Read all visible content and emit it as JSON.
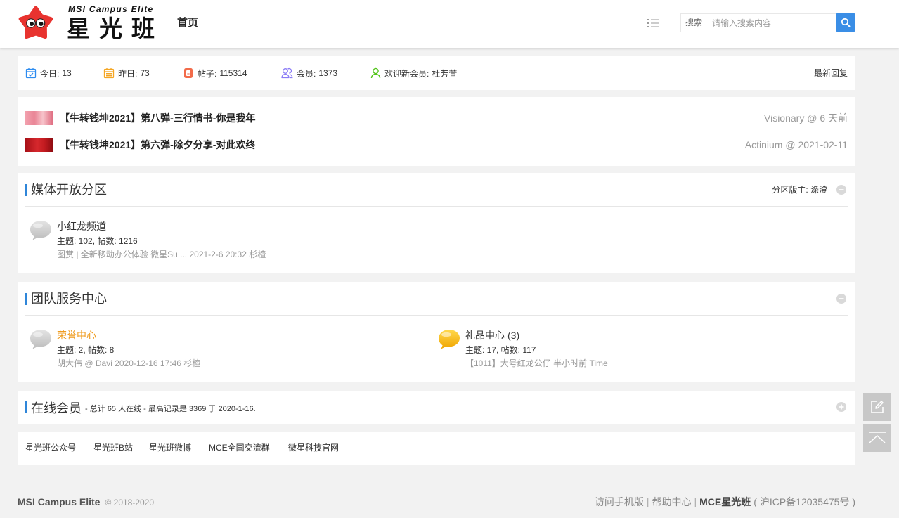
{
  "colors": {
    "accent": "#2f86d9",
    "search_button": "#3a8ee6",
    "highlight_forum": "#ef9b1d",
    "page_bg": "#f2f2f2",
    "logo_red": "#e8332f",
    "float_button": "#c8c8c8"
  },
  "header": {
    "logo_icon": "star-mascot-icon",
    "logo_small": "MSI Campus Elite",
    "logo_big": "星光班",
    "nav_home": "首页",
    "menu_icon": "list-icon",
    "search_label": "搜索",
    "search_placeholder": "请输入搜索内容",
    "search_value": "",
    "search_icon": "search-icon"
  },
  "stats": {
    "today": {
      "label": "今日:",
      "value": "13",
      "icon": "calendar-check-icon"
    },
    "yesterday": {
      "label": "昨日:",
      "value": "73",
      "icon": "calendar-icon"
    },
    "posts": {
      "label": "帖子:",
      "value": "115314",
      "icon": "document-icon"
    },
    "members": {
      "label": "会员:",
      "value": "1373",
      "icon": "users-icon"
    },
    "new_member": {
      "label": "欢迎新会员:",
      "value": "杜芳萱",
      "icon": "user-icon"
    },
    "latest_reply": "最新回复"
  },
  "featured": [
    {
      "title": "【牛转钱坤2021】第八弹-三行情书-你是我年",
      "meta": "Visionary @ 6 天前"
    },
    {
      "title": "【牛转钱坤2021】第六弹-除夕分享-对此欢终",
      "meta": "Actinium @ 2021-02-11"
    }
  ],
  "media_section": {
    "title": "媒体开放分区",
    "moderator": "分区版主: 涤澄",
    "toggle_icon": "collapse-icon",
    "forums": [
      {
        "name": "小红龙频道",
        "stats": "主题: 102, 帖数: 1216",
        "last_post": "图赏 | 全新移动办公体验 微星Su ... 2021-2-6 20:32 杉楂",
        "new_posts": false
      }
    ]
  },
  "team_section": {
    "title": "团队服务中心",
    "toggle_icon": "collapse-icon",
    "forums": [
      {
        "name": "荣誉中心",
        "stats": "主题: 2, 帖数: 8",
        "last_post": "胡大伟 @ Davi 2020-12-16 17:46 杉楂",
        "new_posts": false
      },
      {
        "name": "礼品中心",
        "today": "(3)",
        "stats": "主题: 17, 帖数: 117",
        "last_post": "【1011】大号红龙公仔 半小时前 Time",
        "new_posts": true
      }
    ]
  },
  "online": {
    "title": "在线会员",
    "summary": "- 总计 65 人在线 - 最高记录是 3369 于 2020-1-16.",
    "toggle_icon": "expand-icon"
  },
  "links": [
    "星光班公众号",
    "星光班B站",
    "星光班微博",
    "MCE全国交流群",
    "微星科技官网"
  ],
  "footer": {
    "brand": "MSI Campus Elite",
    "copyright": "© 2018-2020",
    "separator": "|",
    "mobile": "访问手机版",
    "help": "帮助中心",
    "site": "MCE星光班",
    "icp": "( 沪ICP备12035475号 )"
  },
  "float": {
    "post_icon": "edit-icon",
    "top_icon": "back-to-top-icon"
  }
}
